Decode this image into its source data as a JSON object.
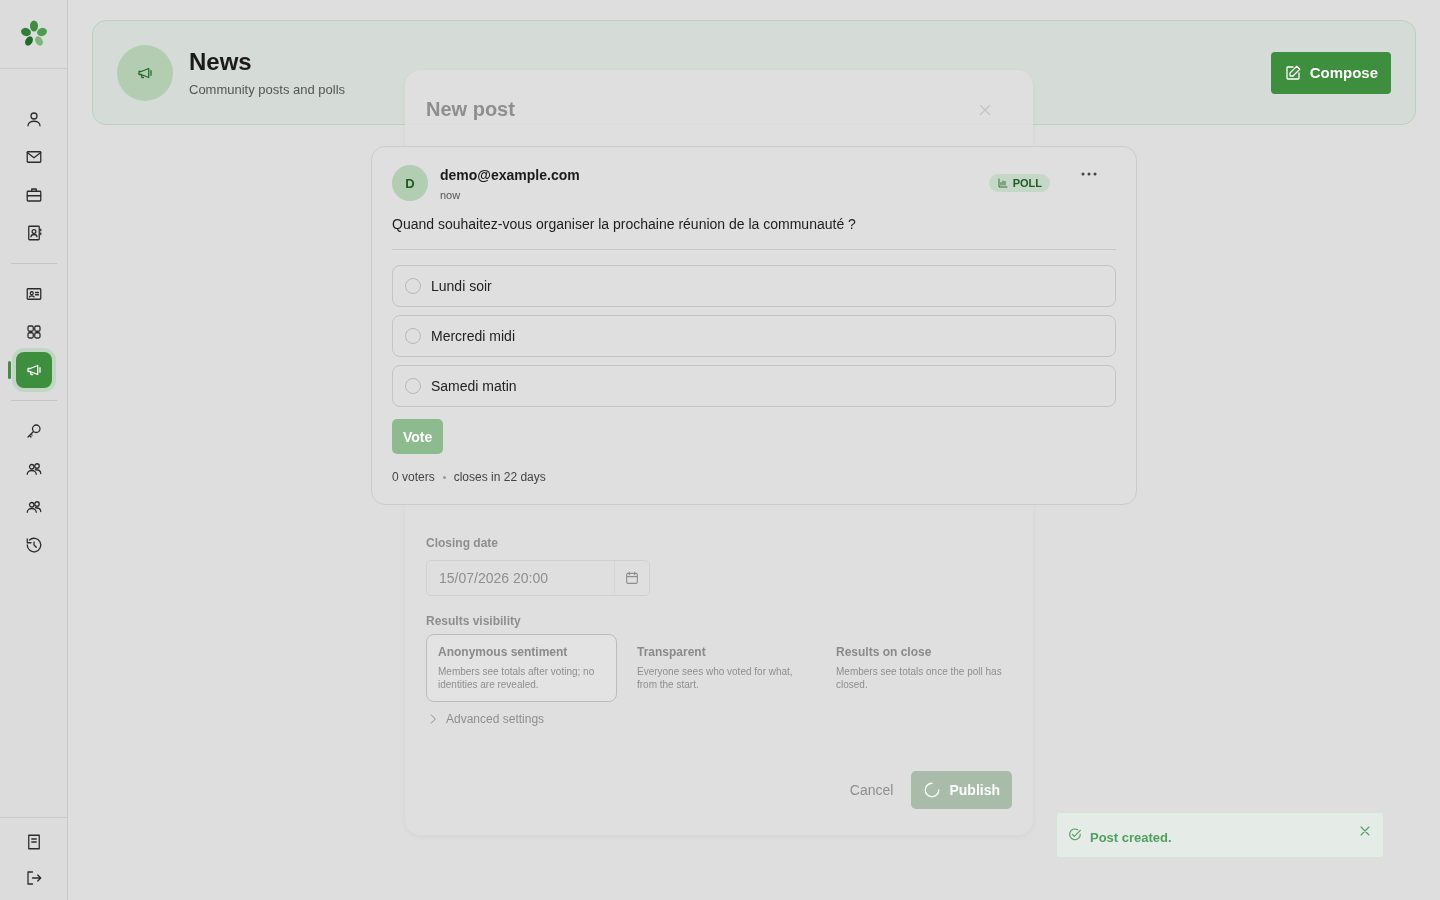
{
  "sidebar": {
    "groups": [
      {
        "items": [
          {
            "selected": false
          },
          {
            "selected": false
          },
          {
            "selected": false
          },
          {
            "selected": false
          }
        ]
      },
      {
        "items": [
          {
            "selected": false
          },
          {
            "selected": false
          },
          {
            "selected": true
          }
        ]
      },
      {
        "items": [
          {
            "selected": false
          },
          {
            "selected": false
          },
          {
            "selected": false
          },
          {
            "selected": false
          }
        ]
      }
    ]
  },
  "header": {
    "title": "News",
    "subtitle": "Community posts and polls",
    "compose_button": "Compose"
  },
  "new_post_dialog": {
    "title": "New post",
    "closing_date": {
      "label": "Closing date",
      "value": "15/07/2026 20:00"
    },
    "results_visibility": {
      "label": "Results visibility",
      "options": [
        {
          "title": "Anonymous sentiment",
          "description": "Members see totals after voting; no identities are revealed.",
          "selected": true
        },
        {
          "title": "Transparent",
          "description": "Everyone sees who voted for what, from the start.",
          "selected": false
        },
        {
          "title": "Results on close",
          "description": "Members see totals once the poll has closed.",
          "selected": false
        }
      ]
    },
    "advanced_settings": "Advanced settings",
    "buttons": [
      {
        "label": "Cancel",
        "kind": "secondary"
      },
      {
        "label": "Publish",
        "kind": "primary"
      }
    ]
  },
  "post": {
    "avatar": "D",
    "author": "demo@example.com",
    "time": "now",
    "badge": "POLL",
    "question": "Quand souhaitez-vous organiser la prochaine réunion de la communauté ?",
    "options": [
      {
        "label": "Lundi soir",
        "selected": false
      },
      {
        "label": "Mercredi midi",
        "selected": false
      },
      {
        "label": "Samedi matin",
        "selected": false
      }
    ],
    "vote_button": {
      "label": "Vote",
      "disabled": true
    },
    "voters": "0 voters",
    "closes": "closes in 22 days"
  },
  "toast": {
    "message": "Post created."
  }
}
